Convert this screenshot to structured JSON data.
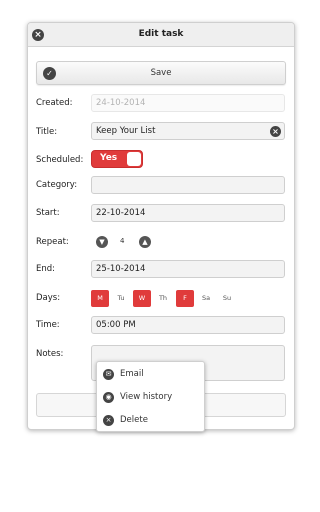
{
  "header": {
    "title": "Edit task"
  },
  "toolbar": {
    "save_label": "Save"
  },
  "fields": {
    "created": {
      "label": "Created:",
      "value": "24-10-2014"
    },
    "title": {
      "label": "Title:",
      "value": "Keep Your List"
    },
    "scheduled": {
      "label": "Scheduled:",
      "value": "Yes"
    },
    "category": {
      "label": "Category:",
      "value": ""
    },
    "start": {
      "label": "Start:",
      "value": "22-10-2014"
    },
    "repeat": {
      "label": "Repeat:",
      "value": "4"
    },
    "end": {
      "label": "End:",
      "value": "25-10-2014"
    },
    "days": {
      "label": "Days:",
      "items": [
        {
          "label": "M",
          "on": true
        },
        {
          "label": "Tu",
          "on": false
        },
        {
          "label": "W",
          "on": true
        },
        {
          "label": "Th",
          "on": false
        },
        {
          "label": "F",
          "on": true
        },
        {
          "label": "Sa",
          "on": false
        },
        {
          "label": "Su",
          "on": false
        }
      ]
    },
    "time": {
      "label": "Time:",
      "value": "05:00 PM"
    },
    "notes": {
      "label": "Notes:",
      "value": ""
    }
  },
  "menu": {
    "items": [
      {
        "label": "Email",
        "icon": "envelope-icon"
      },
      {
        "label": "View history",
        "icon": "eye-icon"
      },
      {
        "label": "Delete",
        "icon": "close-circle-icon"
      }
    ]
  },
  "colors": {
    "accent": "#e03b3b",
    "icon": "#444444"
  }
}
